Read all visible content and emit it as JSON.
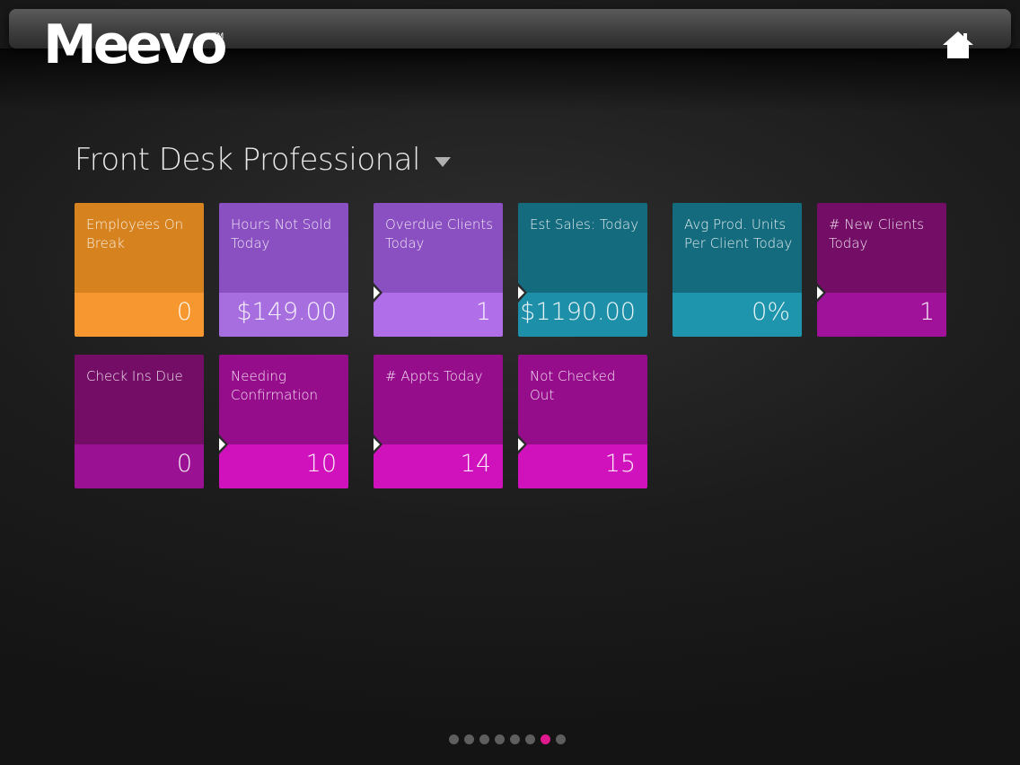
{
  "header": {
    "logo_text": "Meevo",
    "logo_tm": "TM"
  },
  "dashboard": {
    "title": "Front Desk Professional"
  },
  "tiles": [
    {
      "label": "Employees On Break",
      "value": "0",
      "top_color": "#d6821f",
      "bottom_color": "#f7972f",
      "arrow": false
    },
    {
      "label": "Hours Not Sold Today",
      "value": "$149.00",
      "top_color": "#8a4fc0",
      "bottom_color": "#a76ee0",
      "arrow": false
    },
    {
      "label": "Overdue Clients Today",
      "value": "1",
      "top_color": "#8a4fc0",
      "bottom_color": "#b06ee8",
      "arrow": true
    },
    {
      "label": "Est Sales: Today",
      "value": "$1190.00",
      "top_color": "#146b7e",
      "bottom_color": "#1e8fa8",
      "arrow": true
    },
    {
      "label": "Avg Prod. Units Per Client Today",
      "value": "0%",
      "top_color": "#146b7e",
      "bottom_color": "#1e95ad",
      "arrow": false
    },
    {
      "label": "# New Clients Today",
      "value": "1",
      "top_color": "#730d66",
      "bottom_color": "#a0129a",
      "arrow": true
    },
    {
      "label": "Check Ins Due",
      "value": "0",
      "top_color": "#730d66",
      "bottom_color": "#9a1293",
      "arrow": false
    },
    {
      "label": "Needing Confirmation",
      "value": "10",
      "top_color": "#960d8c",
      "bottom_color": "#d012bd",
      "arrow": true
    },
    {
      "label": "# Appts Today",
      "value": "14",
      "top_color": "#960d8c",
      "bottom_color": "#d012bd",
      "arrow": true
    },
    {
      "label": "Not Checked Out",
      "value": "15",
      "top_color": "#960d8c",
      "bottom_color": "#d012bd",
      "arrow": true
    }
  ],
  "pager": {
    "count": 8,
    "active_index": 6
  }
}
